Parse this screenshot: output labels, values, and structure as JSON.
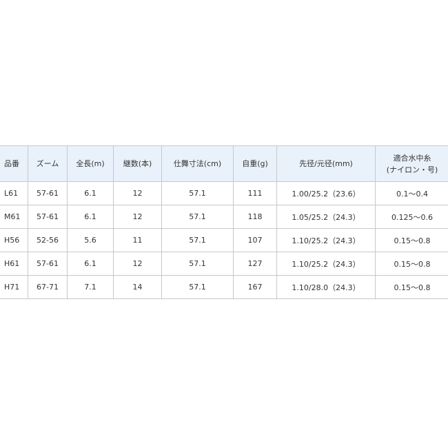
{
  "table": {
    "headers": [
      {
        "lines": [
          "品番"
        ]
      },
      {
        "lines": [
          "ズーム"
        ]
      },
      {
        "lines": [
          "全長(m)"
        ]
      },
      {
        "lines": [
          "継数(本)"
        ]
      },
      {
        "lines": [
          "仕舞寸法(cm)"
        ]
      },
      {
        "lines": [
          "自重(g)"
        ]
      },
      {
        "lines": [
          "先径/元径(mm)"
        ]
      },
      {
        "lines": [
          "適合水中糸",
          "(ナイロン・号)"
        ]
      }
    ],
    "rows": [
      [
        "L61",
        "57-61",
        "6.1",
        "12",
        "57.1",
        "111",
        "1.00/25.2（23.6）",
        "0.1～0.4"
      ],
      [
        "M61",
        "57-61",
        "6.1",
        "12",
        "57.1",
        "118",
        "1.05/25.2（24.3）",
        "0.125～0.6"
      ],
      [
        "H56",
        "52-56",
        "5.6",
        "11",
        "57.1",
        "107",
        "1.10/25.2（24.3）",
        "0.15～0.8"
      ],
      [
        "H61",
        "57-61",
        "6.1",
        "12",
        "57.1",
        "127",
        "1.10/25.2（24.3）",
        "0.15～0.8"
      ],
      [
        "H71",
        "67-71",
        "7.1",
        "14",
        "57.1",
        "167",
        "1.10/28.0（24.3）",
        "0.15～0.8"
      ]
    ]
  },
  "colors": {
    "header_background": "#e9f2fb",
    "border": "#c7c7c7",
    "text": "#333333"
  }
}
